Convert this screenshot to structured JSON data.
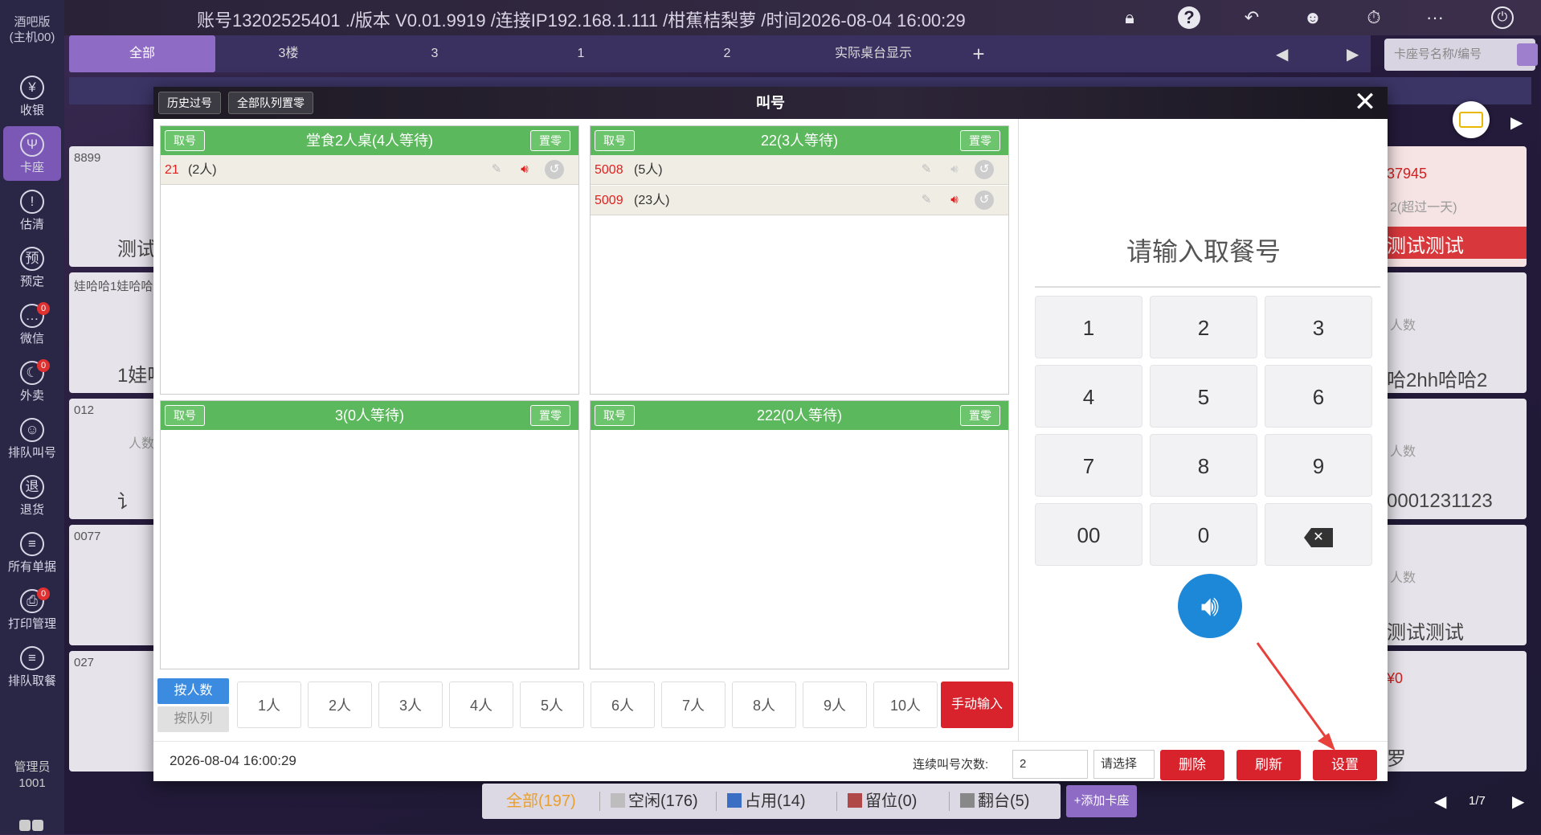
{
  "brand": {
    "line1": "酒吧版",
    "line2": "(主机00)"
  },
  "title_bar": "账号13202525401 ./版本 V0.01.9919 /连接IP192.168.1.111 /柑蕉桔梨萝 /时间2026-08-04 16:00:29",
  "top_icons": [
    "lock-icon",
    "help-icon",
    "back-icon",
    "user-icon",
    "timer-icon",
    "more-icon",
    "power-icon"
  ],
  "sidebar": [
    {
      "label": "收银",
      "glyph": "¥",
      "badge": ""
    },
    {
      "label": "卡座",
      "glyph": "Ψ",
      "badge": "",
      "active": true
    },
    {
      "label": "估清",
      "glyph": "!",
      "badge": ""
    },
    {
      "label": "预定",
      "glyph": "预",
      "badge": ""
    },
    {
      "label": "微信",
      "glyph": "…",
      "badge": "0"
    },
    {
      "label": "外卖",
      "glyph": "☾",
      "badge": "0"
    },
    {
      "label": "排队叫号",
      "glyph": "☺",
      "badge": ""
    },
    {
      "label": "退货",
      "glyph": "退",
      "badge": ""
    },
    {
      "label": "所有单据",
      "glyph": "≡",
      "badge": ""
    },
    {
      "label": "打印管理",
      "glyph": "⎙",
      "badge": "0"
    },
    {
      "label": "排队取餐",
      "glyph": "≡",
      "badge": ""
    }
  ],
  "admin": {
    "line1": "管理员",
    "line2": "1001"
  },
  "tabs": [
    "全部",
    "3楼",
    "3",
    "1",
    "2",
    "实际桌台显示",
    "+"
  ],
  "search_placeholder": "卡座号名称/编号",
  "bg_cards": {
    "left": [
      {
        "code": "8899",
        "name": "测试"
      },
      {
        "code": "娃哈哈1娃哈哈",
        "name": "1娃哈"
      },
      {
        "code": "012",
        "sub": "人数",
        "name": "讠"
      },
      {
        "code": "0077",
        "name": ""
      },
      {
        "code": "027",
        "name": ""
      }
    ],
    "right": [
      {
        "amount": "37945",
        "sub": "2(超过一天)",
        "name": "测试测试"
      },
      {
        "sub": "人数",
        "name": "哈2hh哈哈2"
      },
      {
        "sub": "人数",
        "name": "0001231123"
      },
      {
        "sub": "人数",
        "name": "测试测试"
      },
      {
        "amount": "¥0",
        "name": "罗"
      }
    ]
  },
  "modal": {
    "title": "叫号",
    "history_btn": "历史过号",
    "reset_all_btn": "全部队列置零",
    "queues": [
      {
        "title": "堂食2人桌(4人等待)",
        "take": "取号",
        "reset": "置零",
        "rows": [
          {
            "num": "21",
            "count": "(2人)",
            "active": true
          }
        ]
      },
      {
        "title": "22(3人等待)",
        "take": "取号",
        "reset": "置零",
        "rows": [
          {
            "num": "5008",
            "count": "(5人)",
            "active": false
          },
          {
            "num": "5009",
            "count": "(23人)",
            "active": true
          }
        ]
      },
      {
        "title": "3(0人等待)",
        "take": "取号",
        "reset": "置零",
        "rows": []
      },
      {
        "title": "222(0人等待)",
        "take": "取号",
        "reset": "置零",
        "rows": []
      }
    ],
    "keypad": {
      "title": "请输入取餐号",
      "keys": [
        "1",
        "2",
        "3",
        "4",
        "5",
        "6",
        "7",
        "8",
        "9",
        "00",
        "0",
        "⌫"
      ]
    },
    "by_people": "按人数",
    "by_queue": "按队列",
    "people": [
      "1人",
      "2人",
      "3人",
      "4人",
      "5人",
      "6人",
      "7人",
      "8人",
      "9人",
      "10人"
    ],
    "manual": "手动输入",
    "footer": {
      "datetime": "2026-08-04 16:00:29",
      "repeat_label": "连续叫号次数:",
      "repeat_value": "2",
      "select_placeholder": "请选择",
      "delete": "删除",
      "refresh": "刷新",
      "settings": "设置"
    }
  },
  "statusbar": [
    {
      "label": "全部(197)",
      "color": ""
    },
    {
      "label": "空闲(176)",
      "color": "#bdbdbd"
    },
    {
      "label": "占用(14)",
      "color": "#3b6fc4"
    },
    {
      "label": "留位(0)",
      "color": "#b04848"
    },
    {
      "label": "翻台(5)",
      "color": "#888888"
    }
  ],
  "add_card": "+添加卡座",
  "pager": "1/7",
  "colors": {
    "accent": "#8e6bc4",
    "queue_green": "#5cb85c",
    "danger": "#d8222c",
    "blue": "#1e88d8"
  }
}
